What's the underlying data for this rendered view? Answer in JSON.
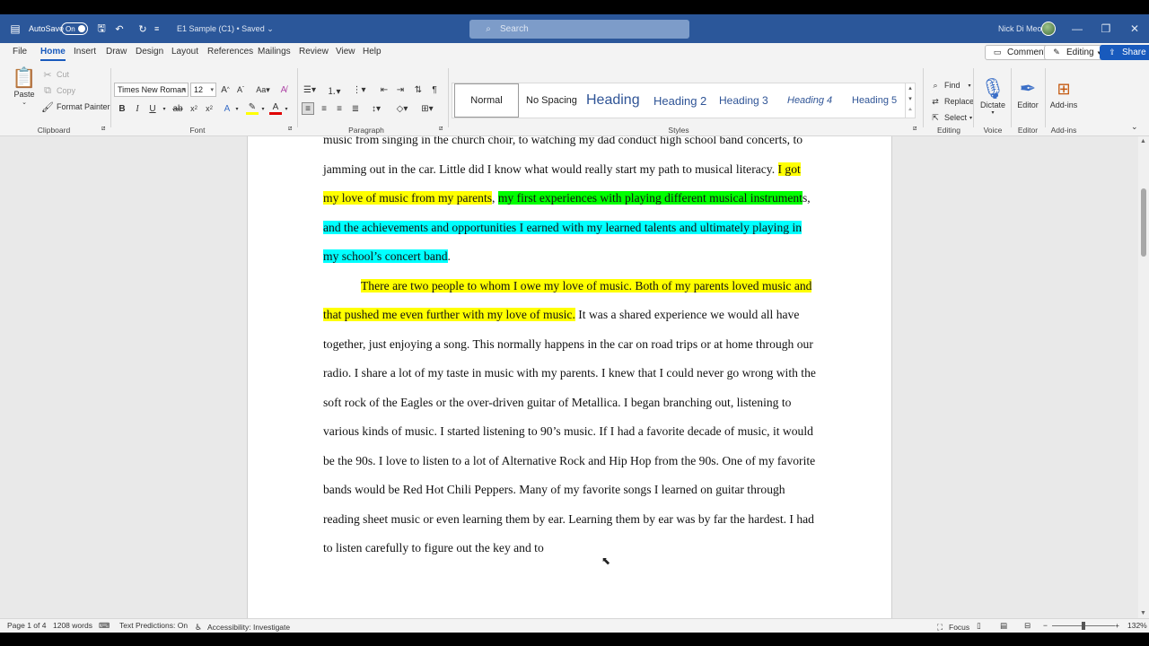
{
  "titlebar": {
    "autosave_label": "AutoSave",
    "autosave_state": "On",
    "doc_title": "E1 Sample (C1) • Saved",
    "search_placeholder": "Search",
    "user_name": "Nick Di Meo",
    "minimize": "—",
    "restore": "❐",
    "close": "✕"
  },
  "menu": {
    "tabs": [
      "File",
      "Home",
      "Insert",
      "Draw",
      "Design",
      "Layout",
      "References",
      "Mailings",
      "Review",
      "View",
      "Help"
    ],
    "comments_label": "Comments",
    "editing_label": "Editing",
    "share_label": "Share"
  },
  "ribbon": {
    "clipboard": {
      "paste": "Paste",
      "cut": "Cut",
      "copy": "Copy",
      "format_painter": "Format Painter",
      "group": "Clipboard"
    },
    "font": {
      "family": "Times New Roman",
      "size": "12",
      "group": "Font"
    },
    "paragraph": {
      "group": "Paragraph"
    },
    "styles": {
      "items": [
        "Normal",
        "No Spacing",
        "Heading",
        "Heading 2",
        "Heading 3",
        "Heading 4",
        "Heading 5"
      ],
      "group": "Styles"
    },
    "editing": {
      "find": "Find",
      "replace": "Replace",
      "select": "Select",
      "group": "Editing"
    },
    "voice": {
      "dictate": "Dictate",
      "group": "Voice"
    },
    "editor": {
      "label": "Editor",
      "group": "Editor"
    },
    "addins": {
      "label": "Add-ins",
      "group": "Add-ins"
    }
  },
  "document": {
    "line_top": "music from singing in the church choir, to watching my dad conduct high school band concerts,",
    "p1_a": "to jamming out in the car. Little did I know what would really start my path to musical literacy. ",
    "p1_hl_yellow": "I got my love of music from my parents",
    "p1_comma1": ", ",
    "p1_hl_green": "my first experiences with playing different musical instrument",
    "p1_s": "s, ",
    "p1_hl_cyan": "and the achievements and opportunities I earned with my learned talents and ultimately playing in my school’s concert band",
    "p1_end": ".",
    "p2_hl_yellow": "There are two people to whom I owe my love of music. Both of my parents loved music and that pushed me even further with my love of music.",
    "p2_rest": " It was a shared experience we would all have together, just enjoying a song. This normally happens in the car on road trips or at home through our radio. I share a lot of my taste in music with my parents. I knew that I could never go wrong with the soft rock of the Eagles or the over-driven guitar of Metallica. I began branching out, listening to various kinds of music. I started listening to 90’s music. If I had a favorite decade of music, it would be the 90s. I love to listen to a lot of Alternative Rock and Hip Hop from the 90s. One of my favorite bands would be Red Hot Chili Peppers. Many of my favorite songs I learned on guitar through reading sheet music or even learning them by ear. Learning them by ear was by far the hardest. I had to listen carefully to figure out the key and to"
  },
  "status": {
    "page": "Page 1 of 4",
    "words": "1208 words",
    "predictions": "Text Predictions: On",
    "accessibility": "Accessibility: Investigate",
    "focus": "Focus",
    "zoom": "132%",
    "zoom_level": 0.5
  }
}
